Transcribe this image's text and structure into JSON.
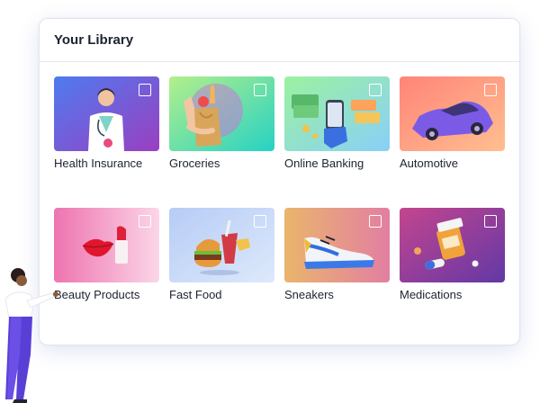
{
  "library": {
    "title": "Your Library",
    "items": [
      {
        "label": "Health Insurance",
        "icon": "doctor-icon",
        "gradient": [
          "#4f7bf0",
          "#8a3fc0"
        ]
      },
      {
        "label": "Groceries",
        "icon": "grocery-bag-icon",
        "gradient": [
          "#a6ee8f",
          "#2fd3c0"
        ]
      },
      {
        "label": "Online Banking",
        "icon": "phone-banking-icon",
        "gradient": [
          "#92f0a8",
          "#8fd3f6"
        ]
      },
      {
        "label": "Automotive",
        "icon": "car-icon",
        "gradient": [
          "#ff8a7a",
          "#ffb98e"
        ]
      },
      {
        "label": "Beauty Products",
        "icon": "lipstick-icon",
        "gradient": [
          "#ef7fb8",
          "#fbd2e6"
        ]
      },
      {
        "label": "Fast Food",
        "icon": "fast-food-icon",
        "gradient": [
          "#b8cff7",
          "#d9e7fb"
        ]
      },
      {
        "label": "Sneakers",
        "icon": "sneaker-icon",
        "gradient": [
          "#e9b06f",
          "#e583a0"
        ]
      },
      {
        "label": "Medications",
        "icon": "pills-icon",
        "gradient": [
          "#c0448f",
          "#6a3aa8"
        ]
      }
    ]
  },
  "colors": {
    "card_border": "#e3e6ee",
    "text": "#1c2230"
  }
}
